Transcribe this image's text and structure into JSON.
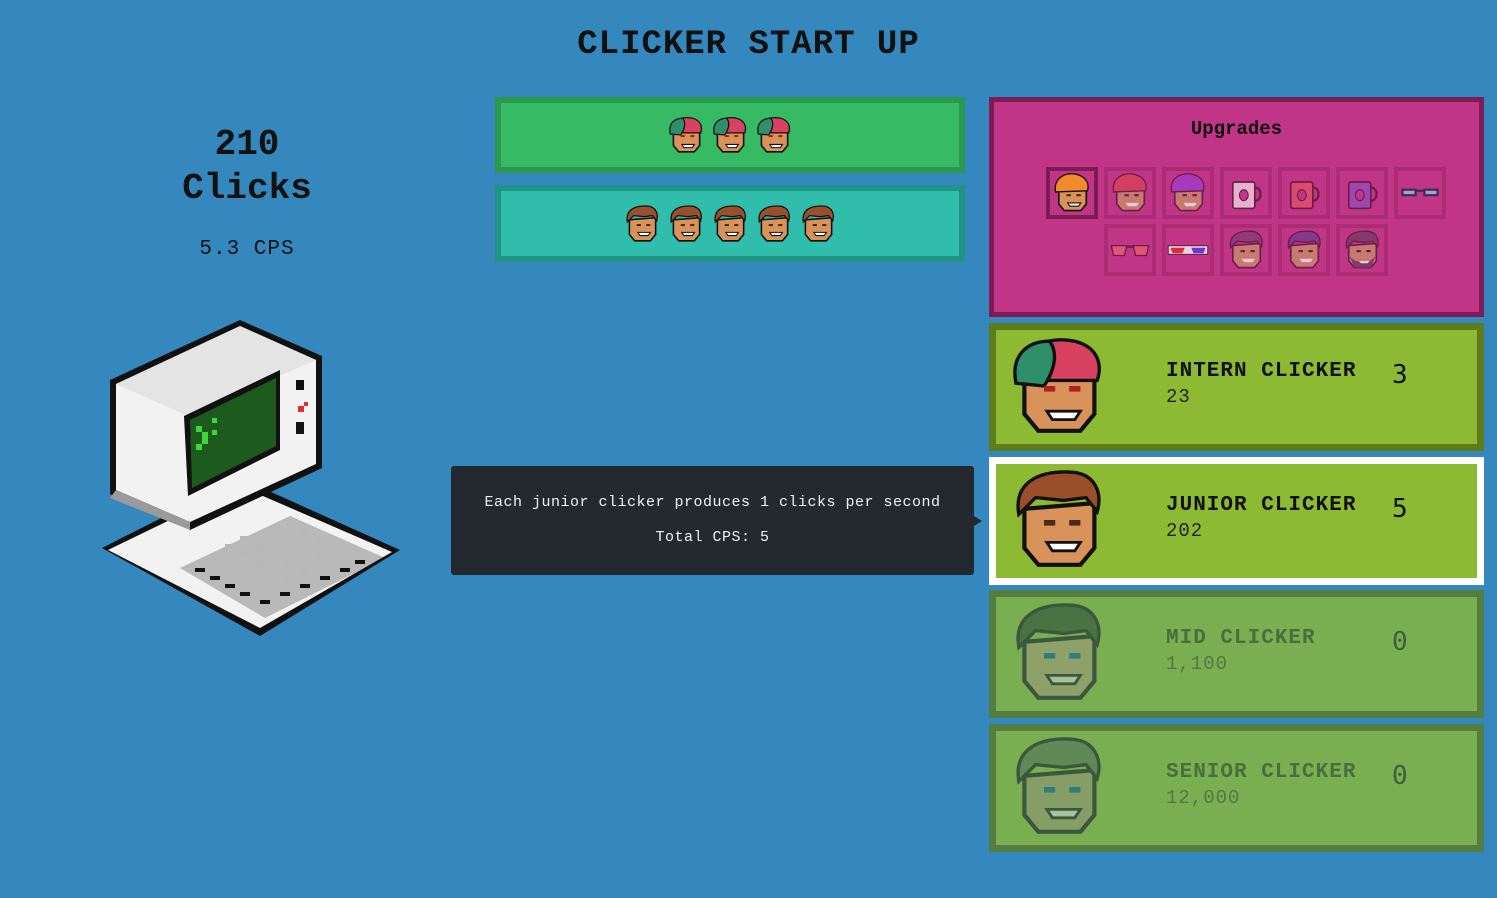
{
  "title": "CLICKER START UP",
  "stats": {
    "clicks": "210",
    "clicks_label": "Clicks",
    "cps": "5.3 CPS"
  },
  "bars": {
    "intern": {
      "count": 3,
      "icon": "intern-face-icon"
    },
    "junior": {
      "count": 5,
      "icon": "junior-face-icon"
    }
  },
  "tooltip": {
    "line1": "Each junior clicker produces 1 clicks per second",
    "line2": "Total CPS: 5"
  },
  "upgrades": {
    "title": "Upgrades",
    "rows": [
      [
        "orange-beanie-face-icon",
        "red-beanie-face-icon",
        "purple-beanie-face-icon",
        "white-mug-icon",
        "red-mug-icon",
        "purple-mug-icon",
        "black-glasses-icon"
      ],
      [
        "red-sunglasses-icon",
        "3d-glasses-icon",
        "purple-hair-face-icon",
        "purple-hair-face-2-icon",
        "bearded-face-icon"
      ]
    ]
  },
  "store": [
    {
      "name": "INTERN CLICKER",
      "price": "23",
      "count": "3",
      "state": "normal"
    },
    {
      "name": "JUNIOR CLICKER",
      "price": "202",
      "count": "5",
      "state": "selected"
    },
    {
      "name": "MID CLICKER",
      "price": "1,100",
      "count": "0",
      "state": "locked"
    },
    {
      "name": "SENIOR CLICKER",
      "price": "12,000",
      "count": "0",
      "state": "locked"
    }
  ],
  "colors": {
    "background": "#3588bd",
    "intern_bar": "#36bb64",
    "junior_bar": "#31bdab",
    "upgrades_panel": "#c03586",
    "store_item": "#8dba33",
    "tooltip": "#23292e"
  }
}
